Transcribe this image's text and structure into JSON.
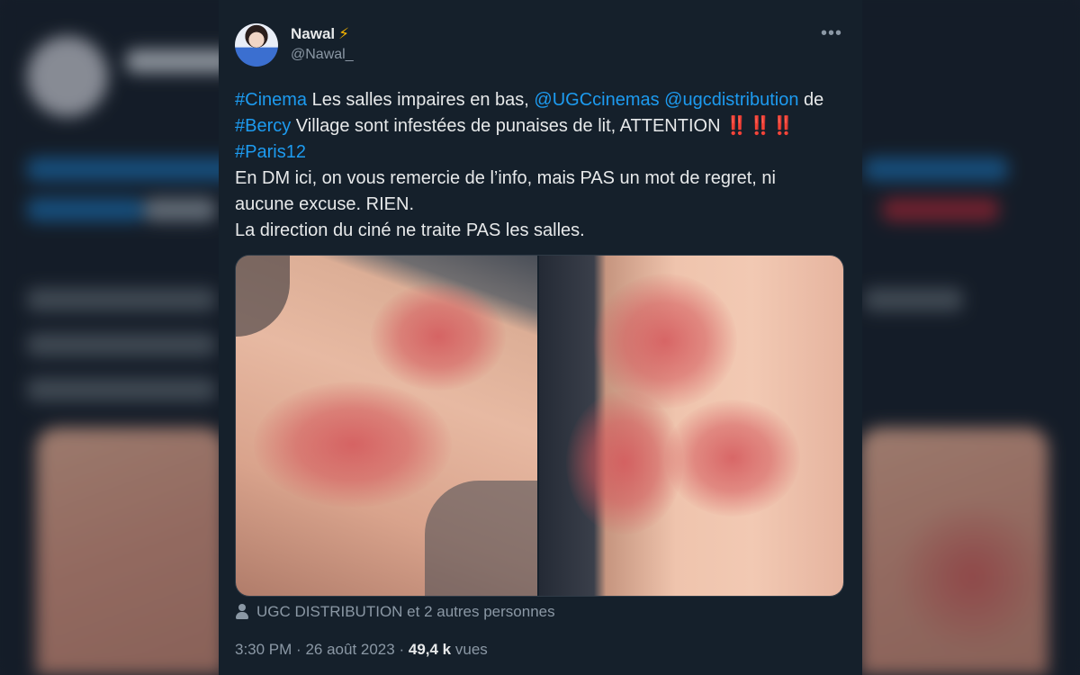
{
  "tweet": {
    "author_name": "Nawal",
    "author_badge": "⚡",
    "handle": "@Nawal_",
    "more_icon": "more-dots-icon",
    "text_lines": [
      [
        {
          "t": "#Cinema",
          "link": true
        },
        {
          "t": " Les salles impaires en bas, "
        },
        {
          "t": "@UGCcinemas",
          "link": true
        },
        {
          "t": " "
        },
        {
          "t": "@ugcdistribution",
          "link": true
        },
        {
          "t": " de"
        }
      ],
      [
        {
          "t": "#Bercy",
          "link": true
        },
        {
          "t": " Village sont infestées de punaises de lit, ATTENTION "
        },
        {
          "t": "‼️‼️‼️",
          "bangs": true
        }
      ],
      [
        {
          "t": "#Paris12",
          "link": true
        }
      ],
      [
        {
          "t": "En DM ici, on vous remercie de l’info, mais PAS un mot de regret, ni"
        }
      ],
      [
        {
          "t": "aucune excuse. RIEN."
        }
      ],
      [
        {
          "t": "La direction du ciné ne traite PAS les salles."
        }
      ]
    ],
    "likers": "UGC DISTRIBUTION et 2 autres personnes",
    "time": "3:30 PM",
    "separator": "·",
    "date": "26 août 2023",
    "views_count": "49,4 k",
    "views_label": "vues"
  },
  "colors": {
    "background": "#15202b",
    "link": "#1d9bf0",
    "muted": "#8b98a5",
    "text": "#e7e9ea"
  }
}
